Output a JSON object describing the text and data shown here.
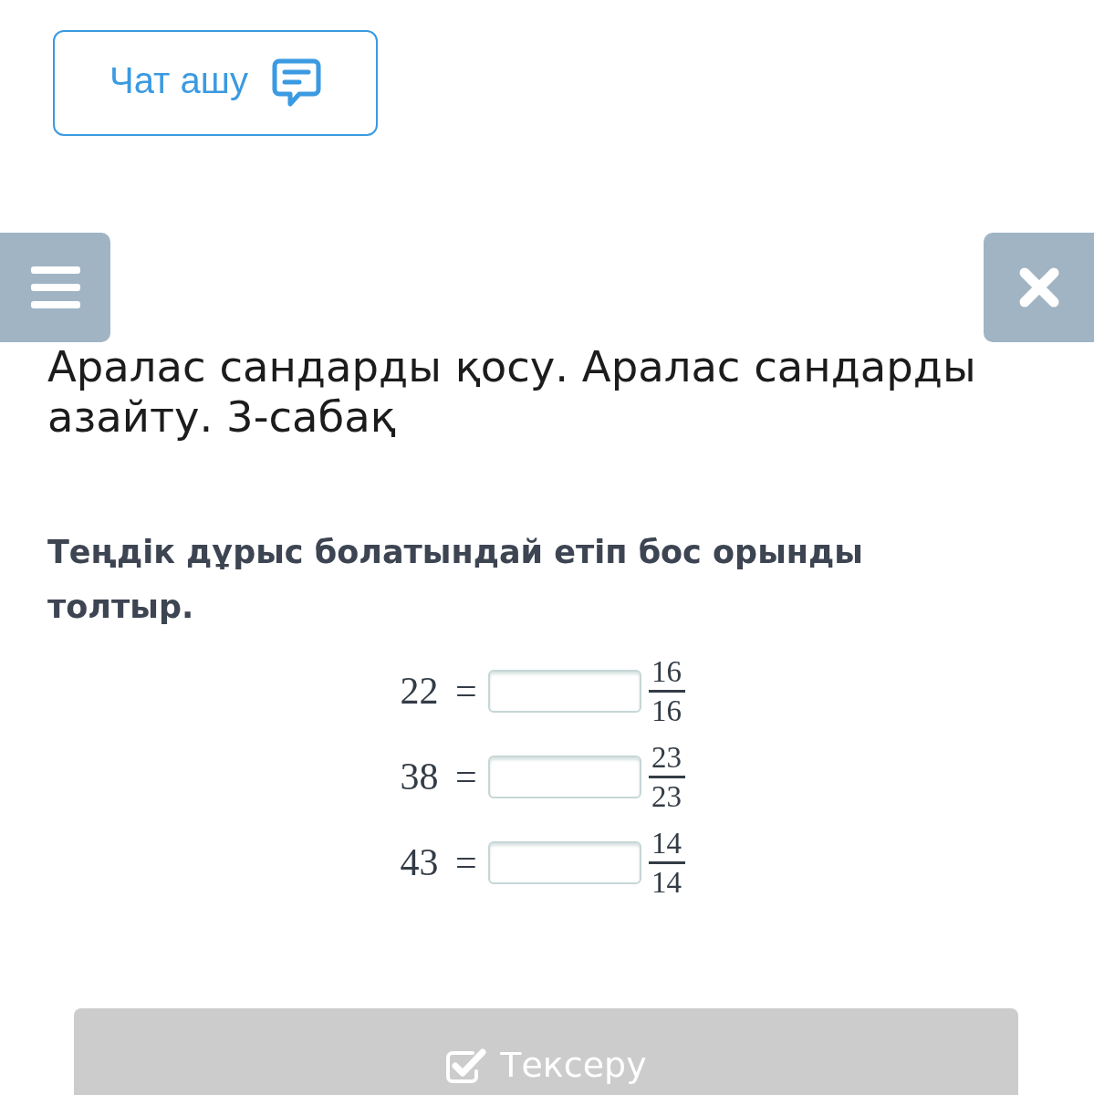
{
  "chat_button": {
    "label": "Чат ашу"
  },
  "lesson": {
    "title": "Аралас сандарды қосу. Аралас сандарды азайту. 3-сабақ"
  },
  "task": {
    "instruction": "Теңдік дұрыс болатындай етіп бос орынды толтыр.",
    "equations": [
      {
        "left_side": "22 =",
        "numerator": "16",
        "denominator": "16"
      },
      {
        "left_side": "38 =",
        "numerator": "23",
        "denominator": "23"
      },
      {
        "left_side": "43 =",
        "numerator": "14",
        "denominator": "14"
      }
    ]
  },
  "check_button": {
    "label": "Тексеру",
    "disabled": true
  }
}
